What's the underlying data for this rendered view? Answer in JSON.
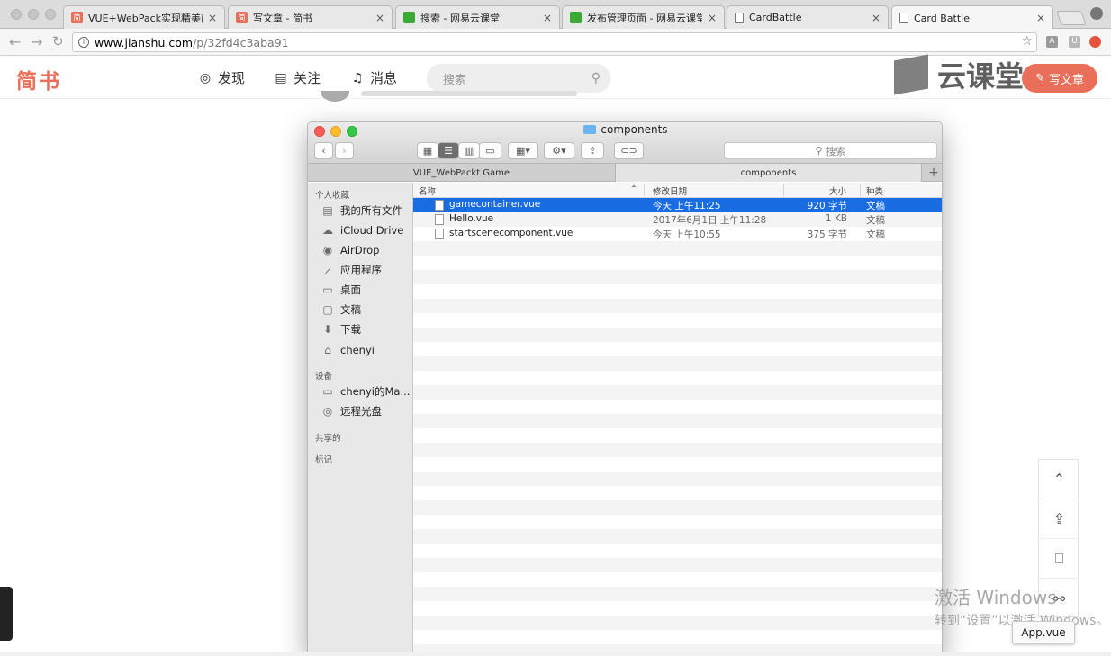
{
  "browser": {
    "tabs": [
      {
        "label": "VUE+WebPack实现精美前端",
        "favicon": "jianshu-icon"
      },
      {
        "label": "写文章 - 简书",
        "favicon": "jianshu-icon"
      },
      {
        "label": "搜索 - 网易云课堂",
        "favicon": "netease-icon"
      },
      {
        "label": "发布管理页面 - 网易云课堂",
        "favicon": "netease-icon"
      },
      {
        "label": "CardBattle",
        "favicon": "document-icon"
      },
      {
        "label": "Card Battle",
        "favicon": "document-icon"
      }
    ],
    "tab_close_glyph": "×",
    "favicon_jianshu_glyph": "简",
    "url_host": "www.jianshu.com",
    "url_path": "/p/32fd4c3aba91",
    "ext_a": "A",
    "ext_u": "U"
  },
  "jianshu": {
    "logo": "简书",
    "nav": [
      {
        "label": "发现",
        "icon": "compass-icon"
      },
      {
        "label": "关注",
        "icon": "book-icon"
      },
      {
        "label": "消息",
        "icon": "bell-icon"
      }
    ],
    "search_placeholder": "搜索",
    "write_button": "写文章",
    "watermark_brand": "云课堂"
  },
  "finder": {
    "title": "components",
    "search_placeholder": "搜索",
    "tabs": [
      "VUE_WebPackt Game",
      "components"
    ],
    "sidebar": {
      "favorites_header": "个人收藏",
      "favorites": [
        {
          "label": "我的所有文件",
          "icon": "all-files-icon"
        },
        {
          "label": "iCloud Drive",
          "icon": "cloud-icon"
        },
        {
          "label": "AirDrop",
          "icon": "airdrop-icon"
        },
        {
          "label": "应用程序",
          "icon": "applications-icon"
        },
        {
          "label": "桌面",
          "icon": "desktop-icon"
        },
        {
          "label": "文稿",
          "icon": "documents-icon"
        },
        {
          "label": "下载",
          "icon": "download-icon"
        },
        {
          "label": "chenyi",
          "icon": "home-icon"
        }
      ],
      "devices_header": "设备",
      "devices": [
        {
          "label": "chenyi的Ma...",
          "icon": "laptop-icon"
        },
        {
          "label": "远程光盘",
          "icon": "disc-icon"
        }
      ],
      "shared_header": "共享的",
      "tags_header": "标记"
    },
    "columns": {
      "name": "名称",
      "date": "修改日期",
      "size": "大小",
      "kind": "种类"
    },
    "files": [
      {
        "name": "gamecontainer.vue",
        "date": "今天 上午11:25",
        "size": "920 字节",
        "kind": "文稿",
        "selected": true
      },
      {
        "name": "Hello.vue",
        "date": "2017年6月1日 上午11:28",
        "size": "1 KB",
        "kind": "文稿",
        "selected": false
      },
      {
        "name": "startscenecomponent.vue",
        "date": "今天 上午10:55",
        "size": "375 字节",
        "kind": "文稿",
        "selected": false
      }
    ]
  },
  "sidepanel": {
    "tooltip": "App.vue"
  },
  "os": {
    "activate_title": "激活 Windows",
    "activate_sub": "转到“设置”以激活 Windows。"
  },
  "colors": {
    "jianshu_accent": "#ea6f5a",
    "finder_selection": "#1a6ce3"
  }
}
